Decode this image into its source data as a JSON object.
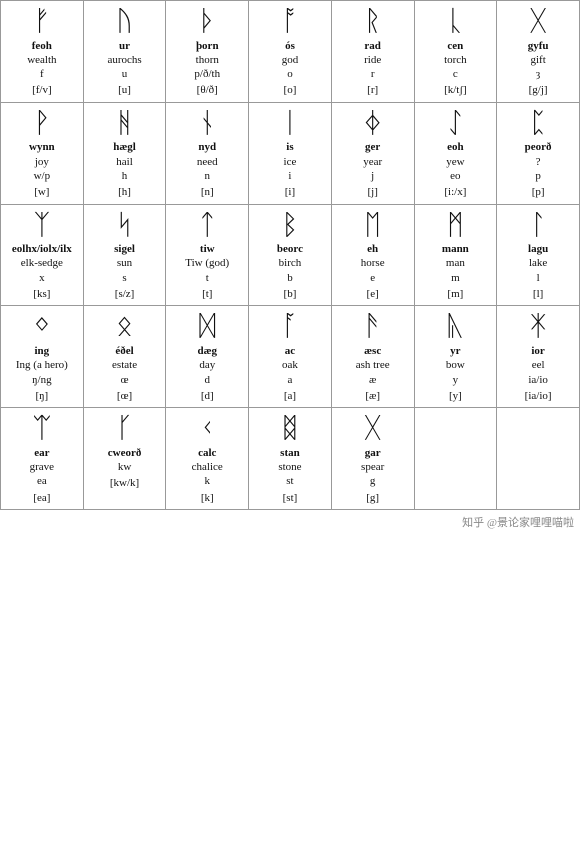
{
  "rows": [
    [
      {
        "symbol": "ᚠ",
        "name": "feoh",
        "meaning": "wealth",
        "letter": "f",
        "phonetic": "[f/v]"
      },
      {
        "symbol": "ᚢ",
        "name": "ur",
        "meaning": "aurochs",
        "letter": "u",
        "phonetic": "[u]"
      },
      {
        "symbol": "ᚦ",
        "name": "þorn",
        "meaning": "thorn",
        "letter": "p/ð/th",
        "phonetic": "[θ/ð]"
      },
      {
        "symbol": "ᚩ",
        "name": "ós",
        "meaning": "god",
        "letter": "o",
        "phonetic": "[o]"
      },
      {
        "symbol": "ᚱ",
        "name": "rad",
        "meaning": "ride",
        "letter": "r",
        "phonetic": "[r]"
      },
      {
        "symbol": "ᚳ",
        "name": "cen",
        "meaning": "torch",
        "letter": "c",
        "phonetic": "[k/tʃ]"
      },
      {
        "symbol": "ᚷ",
        "name": "gyfu",
        "meaning": "gift",
        "letter": "ȝ",
        "phonetic": "[g/j]"
      }
    ],
    [
      {
        "symbol": "ᚹ",
        "name": "wynn",
        "meaning": "joy",
        "letter": "w/p",
        "phonetic": "[w]"
      },
      {
        "symbol": "ᚻ",
        "name": "hægl",
        "meaning": "hail",
        "letter": "h",
        "phonetic": "[h]"
      },
      {
        "symbol": "ᚾ",
        "name": "nyd",
        "meaning": "need",
        "letter": "n",
        "phonetic": "[n]"
      },
      {
        "symbol": "ᛁ",
        "name": "is",
        "meaning": "ice",
        "letter": "i",
        "phonetic": "[i]"
      },
      {
        "symbol": "ᛄ",
        "name": "ger",
        "meaning": "year",
        "letter": "j",
        "phonetic": "[j]"
      },
      {
        "symbol": "ᛇ",
        "name": "eoh",
        "meaning": "yew",
        "letter": "eo",
        "phonetic": "[i:/x]"
      },
      {
        "symbol": "ᛈ",
        "name": "peorð",
        "meaning": "?",
        "letter": "p",
        "phonetic": "[p]"
      }
    ],
    [
      {
        "symbol": "ᛉ",
        "name": "eolhx/iolx/ilx",
        "meaning": "elk-sedge",
        "letter": "x",
        "phonetic": "[ks]"
      },
      {
        "symbol": "ᛋ",
        "name": "sigel",
        "meaning": "sun",
        "letter": "s",
        "phonetic": "[s/z]"
      },
      {
        "symbol": "ᛏ",
        "name": "tiw",
        "meaning": "Tiw (god)",
        "letter": "t",
        "phonetic": "[t]"
      },
      {
        "symbol": "ᛒ",
        "name": "beorc",
        "meaning": "birch",
        "letter": "b",
        "phonetic": "[b]"
      },
      {
        "symbol": "ᛖ",
        "name": "eh",
        "meaning": "horse",
        "letter": "e",
        "phonetic": "[e]"
      },
      {
        "symbol": "ᛗ",
        "name": "mann",
        "meaning": "man",
        "letter": "m",
        "phonetic": "[m]"
      },
      {
        "symbol": "ᛚ",
        "name": "lagu",
        "meaning": "lake",
        "letter": "l",
        "phonetic": "[l]"
      }
    ],
    [
      {
        "symbol": "ᛜ",
        "name": "ing",
        "meaning": "Ing (a hero)",
        "letter": "ŋ/ng",
        "phonetic": "[ŋ]"
      },
      {
        "symbol": "ᛟ",
        "name": "éðel",
        "meaning": "estate",
        "letter": "œ",
        "phonetic": "[œ]"
      },
      {
        "symbol": "ᛞ",
        "name": "dæg",
        "meaning": "day",
        "letter": "d",
        "phonetic": "[d]"
      },
      {
        "symbol": "ᚪ",
        "name": "ac",
        "meaning": "oak",
        "letter": "a",
        "phonetic": "[a]"
      },
      {
        "symbol": "ᚫ",
        "name": "æsc",
        "meaning": "ash tree",
        "letter": "æ",
        "phonetic": "[æ]"
      },
      {
        "symbol": "ᚣ",
        "name": "yr",
        "meaning": "bow",
        "letter": "y",
        "phonetic": "[y]"
      },
      {
        "symbol": "ᛡ",
        "name": "ior",
        "meaning": "eel",
        "letter": "ia/io",
        "phonetic": "[ia/io]"
      }
    ],
    [
      {
        "symbol": "ᛠ",
        "name": "ear",
        "meaning": "grave",
        "letter": "ea",
        "phonetic": "[ea]"
      },
      {
        "symbol": "ᚴ",
        "name": "cweorð",
        "meaning": "",
        "letter": "kw",
        "phonetic": "[kw/k]"
      },
      {
        "symbol": "ᚲ",
        "name": "calc",
        "meaning": "chalice",
        "letter": "k",
        "phonetic": "[k]"
      },
      {
        "symbol": "ᛥ",
        "name": "stan",
        "meaning": "stone",
        "letter": "st",
        "phonetic": "[st]"
      },
      {
        "symbol": "ᚷ",
        "name": "gar",
        "meaning": "spear",
        "letter": "g",
        "phonetic": "[g]"
      },
      {
        "symbol": "",
        "name": "",
        "meaning": "",
        "letter": "",
        "phonetic": ""
      },
      {
        "symbol": "",
        "name": "",
        "meaning": "",
        "letter": "",
        "phonetic": ""
      }
    ]
  ],
  "watermark": "知乎 @景论家哩哩喵啦"
}
